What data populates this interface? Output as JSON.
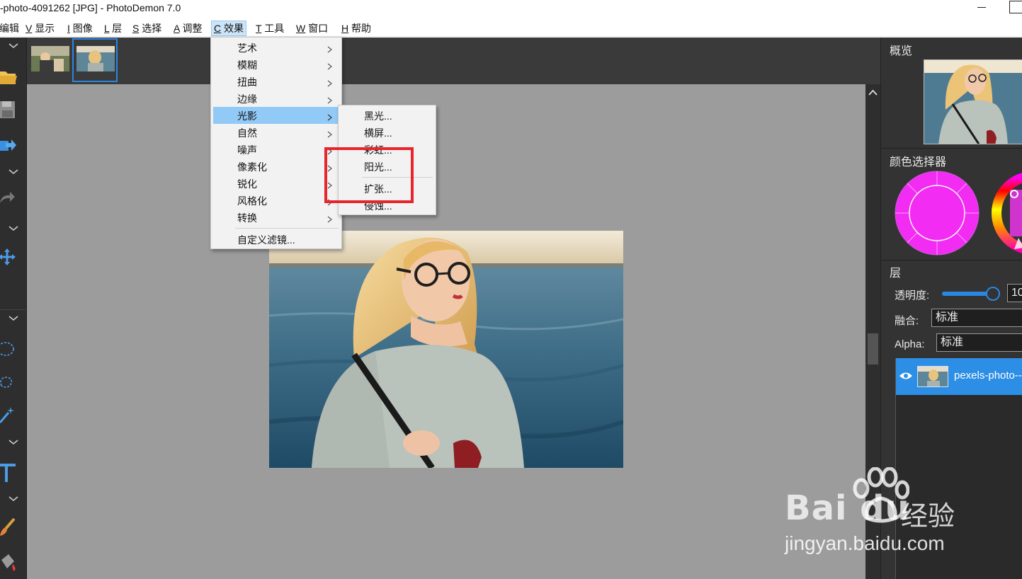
{
  "window": {
    "title": "-photo-4091262 [JPG]  -  PhotoDemon 7.0"
  },
  "menubar": {
    "items": [
      {
        "key": "",
        "label": "编辑"
      },
      {
        "key": "V",
        "label": " 显示"
      },
      {
        "key": "I",
        "label": " 图像"
      },
      {
        "key": "L",
        "label": " 层"
      },
      {
        "key": "S",
        "label": " 选择"
      },
      {
        "key": "A",
        "label": " 调整"
      },
      {
        "key": "C",
        "label": " 效果"
      },
      {
        "key": "T",
        "label": " 工具"
      },
      {
        "key": "W",
        "label": " 窗口"
      },
      {
        "key": "H",
        "label": " 帮助"
      }
    ],
    "active_index": 6
  },
  "effects_menu": {
    "items": [
      {
        "label": "艺术",
        "submenu": true
      },
      {
        "label": "模糊",
        "submenu": true
      },
      {
        "label": "扭曲",
        "submenu": true
      },
      {
        "label": "边缘",
        "submenu": true
      },
      {
        "label": "光影",
        "submenu": true,
        "highlighted": true
      },
      {
        "label": "自然",
        "submenu": true
      },
      {
        "label": "噪声",
        "submenu": true
      },
      {
        "label": "像素化",
        "submenu": true
      },
      {
        "label": "锐化",
        "submenu": true
      },
      {
        "label": "风格化",
        "submenu": true
      },
      {
        "label": "转换",
        "submenu": true
      }
    ],
    "footer_item": "自定义滤镜..."
  },
  "light_submenu": {
    "items": [
      "黑光...",
      "横屏...",
      "彩虹...",
      "阳光...",
      "扩张...",
      "侵蚀..."
    ]
  },
  "right_panel": {
    "overview_title": "概览",
    "color_selector_title": "颜色选择器",
    "primary_color": "#f22cf2",
    "layers_title": "层",
    "opacity_label": "透明度:",
    "opacity_value": "10",
    "blend_label": "融合:",
    "blend_value": "标准",
    "alpha_label": "Alpha:",
    "alpha_value": "标准",
    "layer_name": "pexels-photo--"
  },
  "watermark": {
    "logo": "Bai du",
    "text": "经验",
    "url": "jingyan.baidu.com"
  },
  "colors": {
    "accent": "#2a86e0",
    "annotation": "#e8252d",
    "menu_highlight": "#91c9f7"
  }
}
